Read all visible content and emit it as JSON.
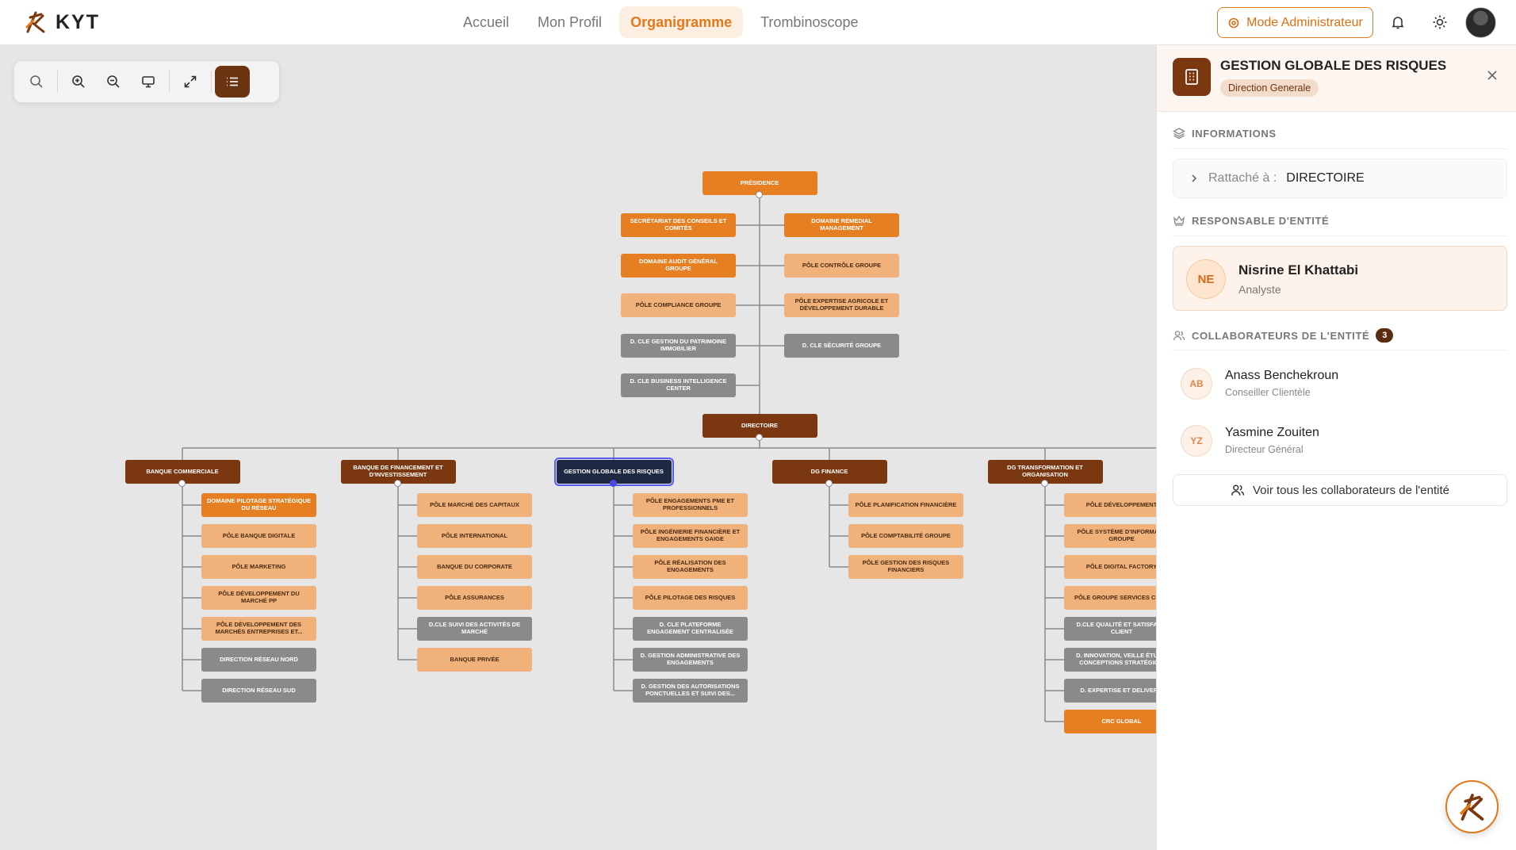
{
  "app": {
    "logo_text": "KYT"
  },
  "nav": {
    "tabs": [
      {
        "label": "Accueil"
      },
      {
        "label": "Mon Profil"
      },
      {
        "label": "Organigramme",
        "active": true
      },
      {
        "label": "Trombinoscope"
      }
    ]
  },
  "header": {
    "admin_label": "Mode Administrateur"
  },
  "toolbar": {
    "icons": [
      "search-icon",
      "zoom-in-icon",
      "zoom-out-icon",
      "monitor-icon",
      "expand-icon",
      "list-icon"
    ]
  },
  "colors": {
    "accent": "#e07a1c",
    "dark_brown": "#7b3810",
    "orange": "#e67e22",
    "light_orange": "#f0b27a",
    "gray": "#8a8a8a",
    "selected": "#1e2a44"
  },
  "org": {
    "presidence": "Présidence",
    "presidence_children": [
      {
        "label": "Secrétariat des Conseils et Comités",
        "style": "orange"
      },
      {
        "label": "Domaine Remedial Management",
        "style": "orange"
      },
      {
        "label": "Domaine Audit Général Groupe",
        "style": "orange"
      },
      {
        "label": "Pôle Contrôle Groupe",
        "style": "light"
      },
      {
        "label": "Pôle Compliance Groupe",
        "style": "light"
      },
      {
        "label": "Pôle Expertise Agricole et Développement Durable",
        "style": "light"
      },
      {
        "label": "D. CLE Gestion du Patrimoine Immobilier",
        "style": "gray"
      },
      {
        "label": "D. CLE Sécurité Groupe",
        "style": "gray"
      },
      {
        "label": "D. CLE Business Intelligence Center",
        "style": "gray"
      }
    ],
    "directoire": "Directoire",
    "branches": [
      {
        "label": "Banque Commerciale",
        "children": [
          {
            "label": "Domaine Pilotage Stratégique du Réseau",
            "style": "orange"
          },
          {
            "label": "Pôle Banque Digitale",
            "style": "light"
          },
          {
            "label": "Pôle Marketing",
            "style": "light"
          },
          {
            "label": "Pôle Développement du Marché PP",
            "style": "light"
          },
          {
            "label": "Pôle Développement des Marchés Entreprises et...",
            "style": "light"
          },
          {
            "label": "Direction Réseau Nord",
            "style": "gray"
          },
          {
            "label": "Direction Réseau Sud",
            "style": "gray"
          }
        ]
      },
      {
        "label": "Banque de Financement et d'Investissement",
        "children": [
          {
            "label": "Pôle Marché des Capitaux",
            "style": "light"
          },
          {
            "label": "Pôle International",
            "style": "light"
          },
          {
            "label": "Banque du Corporate",
            "style": "light"
          },
          {
            "label": "Pôle Assurances",
            "style": "light"
          },
          {
            "label": "D.CLE Suivi des Activités de Marché",
            "style": "gray"
          },
          {
            "label": "Banque Privée",
            "style": "light"
          }
        ]
      },
      {
        "label": "Gestion Globale des Risques",
        "selected": true,
        "children": [
          {
            "label": "Pôle Engagements PME et Professionnels",
            "style": "light"
          },
          {
            "label": "Pôle Ingénierie Financière et Engagements Gaige",
            "style": "light"
          },
          {
            "label": "Pôle Réalisation des Engagements",
            "style": "light"
          },
          {
            "label": "Pôle Pilotage des Risques",
            "style": "light"
          },
          {
            "label": "D. CLE Plateforme Engagement Centralisée",
            "style": "gray"
          },
          {
            "label": "D. Gestion Administrative des Engagements",
            "style": "gray"
          },
          {
            "label": "D. Gestion des Autorisations Ponctuelles et Suivi des...",
            "style": "gray"
          }
        ]
      },
      {
        "label": "DG Finance",
        "children": [
          {
            "label": "Pôle Planification Financière",
            "style": "light"
          },
          {
            "label": "Pôle Comptabilité Groupe",
            "style": "light"
          },
          {
            "label": "Pôle Gestion des Risques Financiers",
            "style": "light"
          }
        ]
      },
      {
        "label": "DG Transformation et Organisation",
        "children": [
          {
            "label": "Pôle Développement",
            "style": "light"
          },
          {
            "label": "Pôle Système d'Informat... Groupe",
            "style": "light"
          },
          {
            "label": "Pôle Digital Factory",
            "style": "light"
          },
          {
            "label": "Pôle Groupe Services Cen...",
            "style": "light"
          },
          {
            "label": "D.CLE Qualité et Satisfac... Client",
            "style": "gray"
          },
          {
            "label": "D. Innovation, Veille Étud... Conceptions Stratégiq...",
            "style": "gray"
          },
          {
            "label": "D. Expertise et Deliver...",
            "style": "gray"
          },
          {
            "label": "CRC Global",
            "style": "orange"
          }
        ]
      }
    ]
  },
  "panel": {
    "title": "GESTION GLOBALE DES RISQUES",
    "badge": "Direction Generale",
    "sections": {
      "informations": "INFORMATIONS",
      "responsable": "RESPONSABLE D'ENTITÉ",
      "collaborateurs": "COLLABORATEURS DE L'ENTITÉ"
    },
    "rattache_label": "Rattaché à :",
    "rattache_value": "DIRECTOIRE",
    "responsable": {
      "initials": "NE",
      "name": "Nisrine El Khattabi",
      "role": "Analyste"
    },
    "collab_count": "3",
    "collaborateurs": [
      {
        "initials": "AB",
        "name": "Anass Benchekroun",
        "role": "Conseiller Clientèle"
      },
      {
        "initials": "YZ",
        "name": "Yasmine Zouiten",
        "role": "Directeur Général"
      }
    ],
    "see_all": "Voir tous les collaborateurs de l'entité"
  }
}
